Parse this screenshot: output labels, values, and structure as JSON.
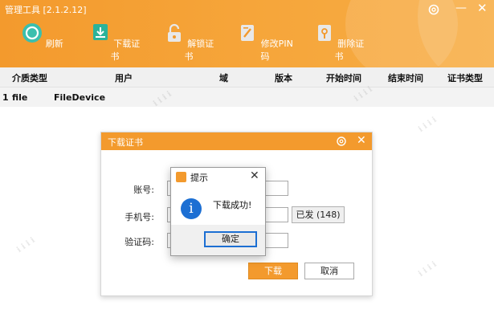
{
  "app": {
    "title": "管理工具 [2.1.2.12]"
  },
  "toolbar": {
    "items": [
      {
        "label": "刷新",
        "icon": "refresh-icon"
      },
      {
        "label": "下载证书",
        "icon": "download-cert-icon"
      },
      {
        "label": "解锁证书",
        "icon": "unlock-icon"
      },
      {
        "label": "修改PIN码",
        "icon": "edit-pin-icon"
      },
      {
        "label": "删除证书",
        "icon": "delete-cert-icon"
      }
    ]
  },
  "table": {
    "columns": [
      "介质类型",
      "用户",
      "域",
      "版本",
      "开始时间",
      "结束时间",
      "证书类型"
    ],
    "rows": [
      {
        "index": "1",
        "media": "file",
        "user": "FileDevice"
      }
    ]
  },
  "download_dialog": {
    "title": "下载证书",
    "account_label": "账号:",
    "phone_label": "手机号:",
    "code_label": "验证码:",
    "account_value": "",
    "phone_value": "",
    "code_value": "",
    "resend_label": "已发 (148)",
    "download_label": "下载",
    "cancel_label": "取消"
  },
  "message_box": {
    "title": "提示",
    "text": "下载成功!",
    "ok_label": "确定"
  },
  "colors": {
    "accent": "#f39a2d",
    "info_blue": "#1c6fd3"
  }
}
